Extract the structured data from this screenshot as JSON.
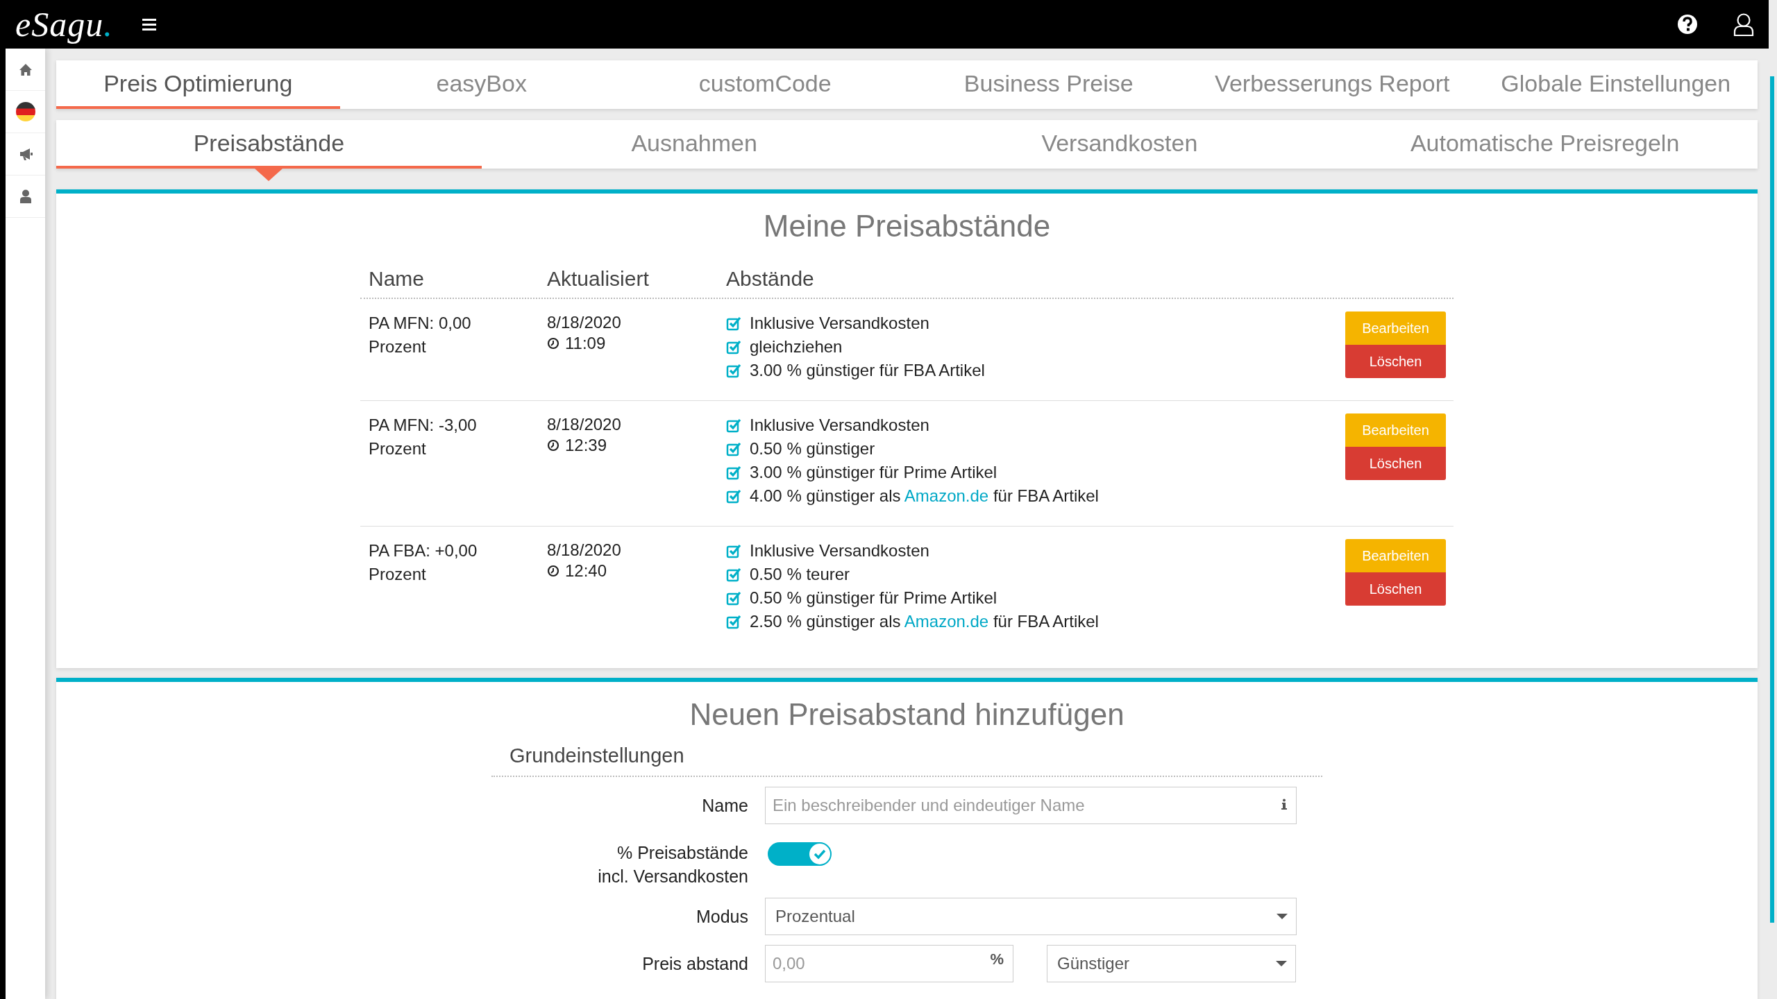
{
  "header": {
    "logo": "eSagu",
    "logo_dot": "."
  },
  "main_tabs": [
    {
      "label": "Preis Optimierung",
      "selected": true
    },
    {
      "label": "easyBox",
      "selected": false
    },
    {
      "label": "customCode",
      "selected": false
    },
    {
      "label": "Business Preise",
      "selected": false
    },
    {
      "label": "Verbesserungs Report",
      "selected": false
    },
    {
      "label": "Globale Einstellungen",
      "selected": false
    }
  ],
  "sub_tabs": [
    {
      "label": "Preisabstände",
      "selected": true
    },
    {
      "label": "Ausnahmen",
      "selected": false
    },
    {
      "label": "Versandkosten",
      "selected": false
    },
    {
      "label": "Automatische Preisregeln",
      "selected": false
    }
  ],
  "price_gaps": {
    "title": "Meine Preisabstände",
    "columns": [
      "Name",
      "Aktualisiert",
      "Abstände"
    ],
    "rows": [
      {
        "name": "PA MFN: 0,00 Prozent",
        "date": "8/18/2020",
        "time": "11:09",
        "edit": "Bearbeiten",
        "delete": "Löschen",
        "gaps": [
          {
            "text": "Inklusive Versandkosten",
            "checked": true
          },
          {
            "text": "gleichziehen",
            "checked": true
          },
          {
            "text": "3.00 % günstiger für FBA Artikel",
            "checked": true
          }
        ]
      },
      {
        "name": "PA MFN: -3,00 Prozent",
        "date": "8/18/2020",
        "time": "12:39",
        "edit": "Bearbeiten",
        "delete": "Löschen",
        "gaps": [
          {
            "text": "Inklusive Versandkosten",
            "checked": true
          },
          {
            "text": "0.50 % günstiger",
            "checked": true
          },
          {
            "text": "3.00 % günstiger für Prime Artikel",
            "checked": true
          },
          {
            "text": "4.00 % günstiger als",
            "link": "Amazon.de",
            "text_after": "für FBA Artikel",
            "checked": true
          }
        ]
      },
      {
        "name": "PA FBA: +0,00 Prozent",
        "date": "8/18/2020",
        "time": "12:40",
        "edit": "Bearbeiten",
        "delete": "Löschen",
        "gaps": [
          {
            "text": "Inklusive Versandkosten",
            "checked": true
          },
          {
            "text": "0.50 % teurer",
            "checked": true
          },
          {
            "text": "0.50 % günstiger für Prime Artikel",
            "checked": true
          },
          {
            "text": "2.50 % günstiger als",
            "link": "Amazon.de",
            "text_after": "für FBA Artikel",
            "checked": true
          }
        ]
      }
    ]
  },
  "new_gap": {
    "title": "Neuen Preisabstand hinzufügen",
    "section": "Grundeinstellungen",
    "name": {
      "label": "Name",
      "placeholder": "Ein beschreibender und eindeutiger Name"
    },
    "shipping_toggle": {
      "label": "% Preisabstände incl. Versandkosten",
      "on": true
    },
    "mode": {
      "label": "Modus",
      "value": "Prozentual"
    },
    "gap": {
      "label": "Preis abstand",
      "placeholder": "0,00",
      "unit": "%",
      "direction": "Günstiger"
    }
  }
}
